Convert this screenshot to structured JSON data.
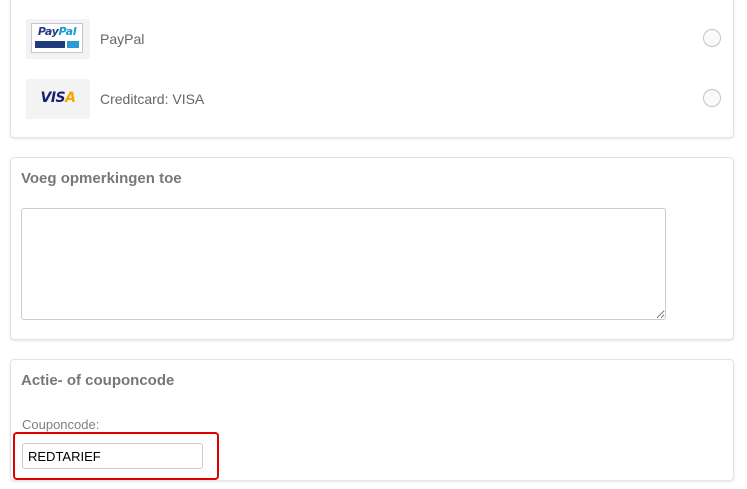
{
  "payment_methods": [
    {
      "name": "PayPal",
      "logo_icon": "paypal-logo-icon",
      "logo_text_a": "Pay",
      "logo_text_b": "Pal",
      "selected": false
    },
    {
      "name": "Creditcard: VISA",
      "logo_icon": "visa-logo-icon",
      "logo_text_a": "VIS",
      "logo_text_b": "A",
      "selected": false
    }
  ],
  "remarks": {
    "title": "Voeg opmerkingen toe",
    "value": ""
  },
  "coupon": {
    "title": "Actie- of couponcode",
    "label": "Couponcode:",
    "value": "REDTARIEF"
  },
  "colors": {
    "highlight": "#e00000",
    "paypal_dark": "#253b80",
    "paypal_light": "#179bd7",
    "visa_blue": "#1a1f71",
    "visa_gold": "#f7a600"
  }
}
